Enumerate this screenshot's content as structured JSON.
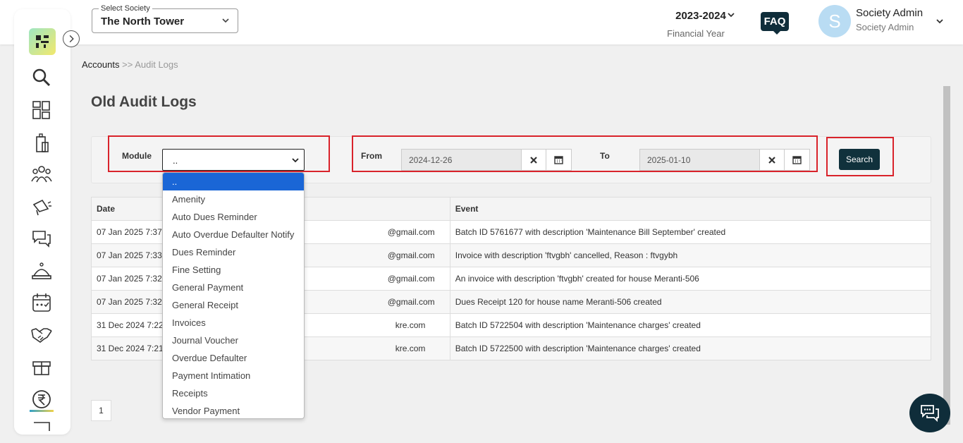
{
  "header": {
    "society_select_label": "Select Society",
    "society_select_value": "The North Tower",
    "financial_year": "2023-2024",
    "financial_year_caption": "Financial Year",
    "faq_label": "FAQ",
    "avatar_initial": "S",
    "user_name": "Society Admin",
    "user_role": "Society Admin"
  },
  "sidebar": {
    "icons": [
      "logo-icon",
      "search-icon",
      "dashboard-icon",
      "building-icon",
      "members-icon",
      "announcement-icon",
      "chat-bubbles-icon",
      "helpdesk-icon",
      "calendar-icon",
      "handshake-icon",
      "gift-icon",
      "rupee-icon"
    ]
  },
  "breadcrumb": {
    "root": "Accounts",
    "separator": ">>",
    "current": "Audit Logs"
  },
  "page_title": "Old Audit Logs",
  "filter": {
    "module_label": "Module",
    "module_value": "..",
    "from_label": "From",
    "from_value": "2024-12-26",
    "to_label": "To",
    "to_value": "2025-01-10",
    "search_label": "Search"
  },
  "module_options": [
    "..",
    "Amenity",
    "Auto Dues Reminder",
    "Auto Overdue Defaulter Notify",
    "Dues Reminder",
    "Fine Setting",
    "General Payment",
    "General Receipt",
    "Invoices",
    "Journal Voucher",
    "Overdue Defaulter",
    "Payment Intimation",
    "Receipts",
    "Vendor Payment"
  ],
  "table": {
    "headers": {
      "date": "Date",
      "user": "",
      "event": "Event"
    },
    "rows": [
      {
        "date": "07 Jan 2025 7:37 p",
        "user": "@gmail.com",
        "event": "Batch ID 5761677 with description 'Maintenance Bill September' created"
      },
      {
        "date": "07 Jan 2025 7:33 p",
        "user": "@gmail.com",
        "event": "Invoice with description 'ftvgbh' cancelled, Reason : ftvgybh"
      },
      {
        "date": "07 Jan 2025 7:32 p",
        "user": "@gmail.com",
        "event": "An invoice with description 'ftvgbh' created for house Meranti-506"
      },
      {
        "date": "07 Jan 2025 7:32 p",
        "user": "@gmail.com",
        "event": "Dues Receipt 120 for house name Meranti-506 created"
      },
      {
        "date": "31 Dec 2024 7:22 p",
        "user": "kre.com",
        "event": "Batch ID 5722504 with description 'Maintenance charges' created"
      },
      {
        "date": "31 Dec 2024 7:21 p",
        "user": "kre.com",
        "event": "Batch ID 5722500 with description 'Maintenance charges' created"
      }
    ]
  },
  "pagination": {
    "page": "1"
  },
  "colors": {
    "highlight": "#d9232b",
    "primary_dark": "#10313c",
    "selected_option": "#1a66d6"
  }
}
